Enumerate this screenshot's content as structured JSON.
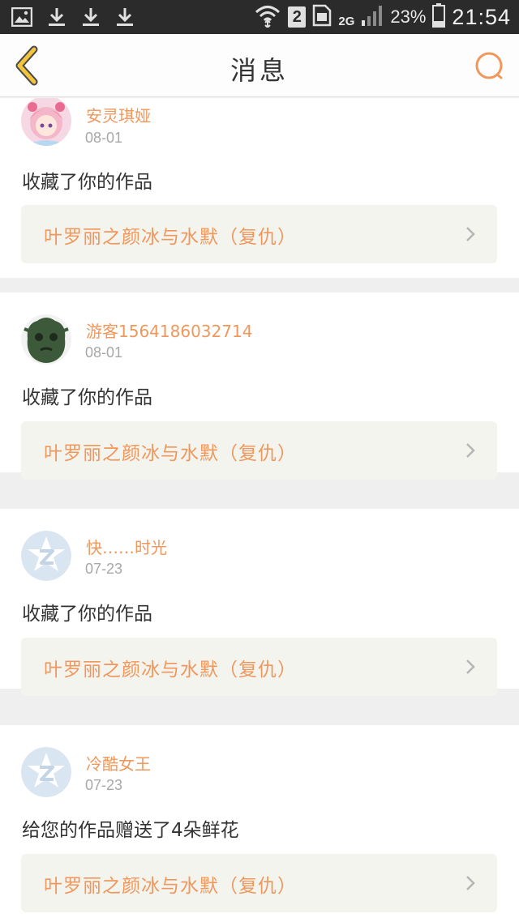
{
  "status_bar": {
    "network": "2G",
    "sim": "2",
    "battery": "23%",
    "time": "21:54",
    "icons": [
      "image-icon",
      "download-icon",
      "download-icon",
      "download-icon",
      "wifi-icon",
      "sim-icon",
      "signal-icon",
      "battery-icon"
    ]
  },
  "header": {
    "title": "消息",
    "back_icon": "chevron-left-icon",
    "search_icon": "search-icon"
  },
  "colors": {
    "accent": "#f0975c",
    "back_icon": "#f2c53d",
    "card_bg": "#ffffff",
    "page_bg": "#efefef",
    "link_bg": "#f4f4ef"
  },
  "messages": [
    {
      "username": "安灵琪娅",
      "date": "08-01",
      "action": "收藏了你的作品",
      "work": "叶罗丽之颜冰与水默（复仇）",
      "avatar": "anime-girl-avatar"
    },
    {
      "username": "游客1564186032714",
      "date": "08-01",
      "action": "收藏了你的作品",
      "work": "叶罗丽之颜冰与水默（复仇）",
      "avatar": "green-cartoon-avatar"
    },
    {
      "username": "快……时光",
      "date": "07-23",
      "action": "收藏了你的作品",
      "work": "叶罗丽之颜冰与水默（复仇）",
      "avatar": "default-qq-avatar"
    },
    {
      "username": "冷酷女王",
      "date": "07-23",
      "action": "给您的作品赠送了4朵鲜花",
      "work": "叶罗丽之颜冰与水默（复仇）",
      "avatar": "default-qq-avatar"
    }
  ]
}
